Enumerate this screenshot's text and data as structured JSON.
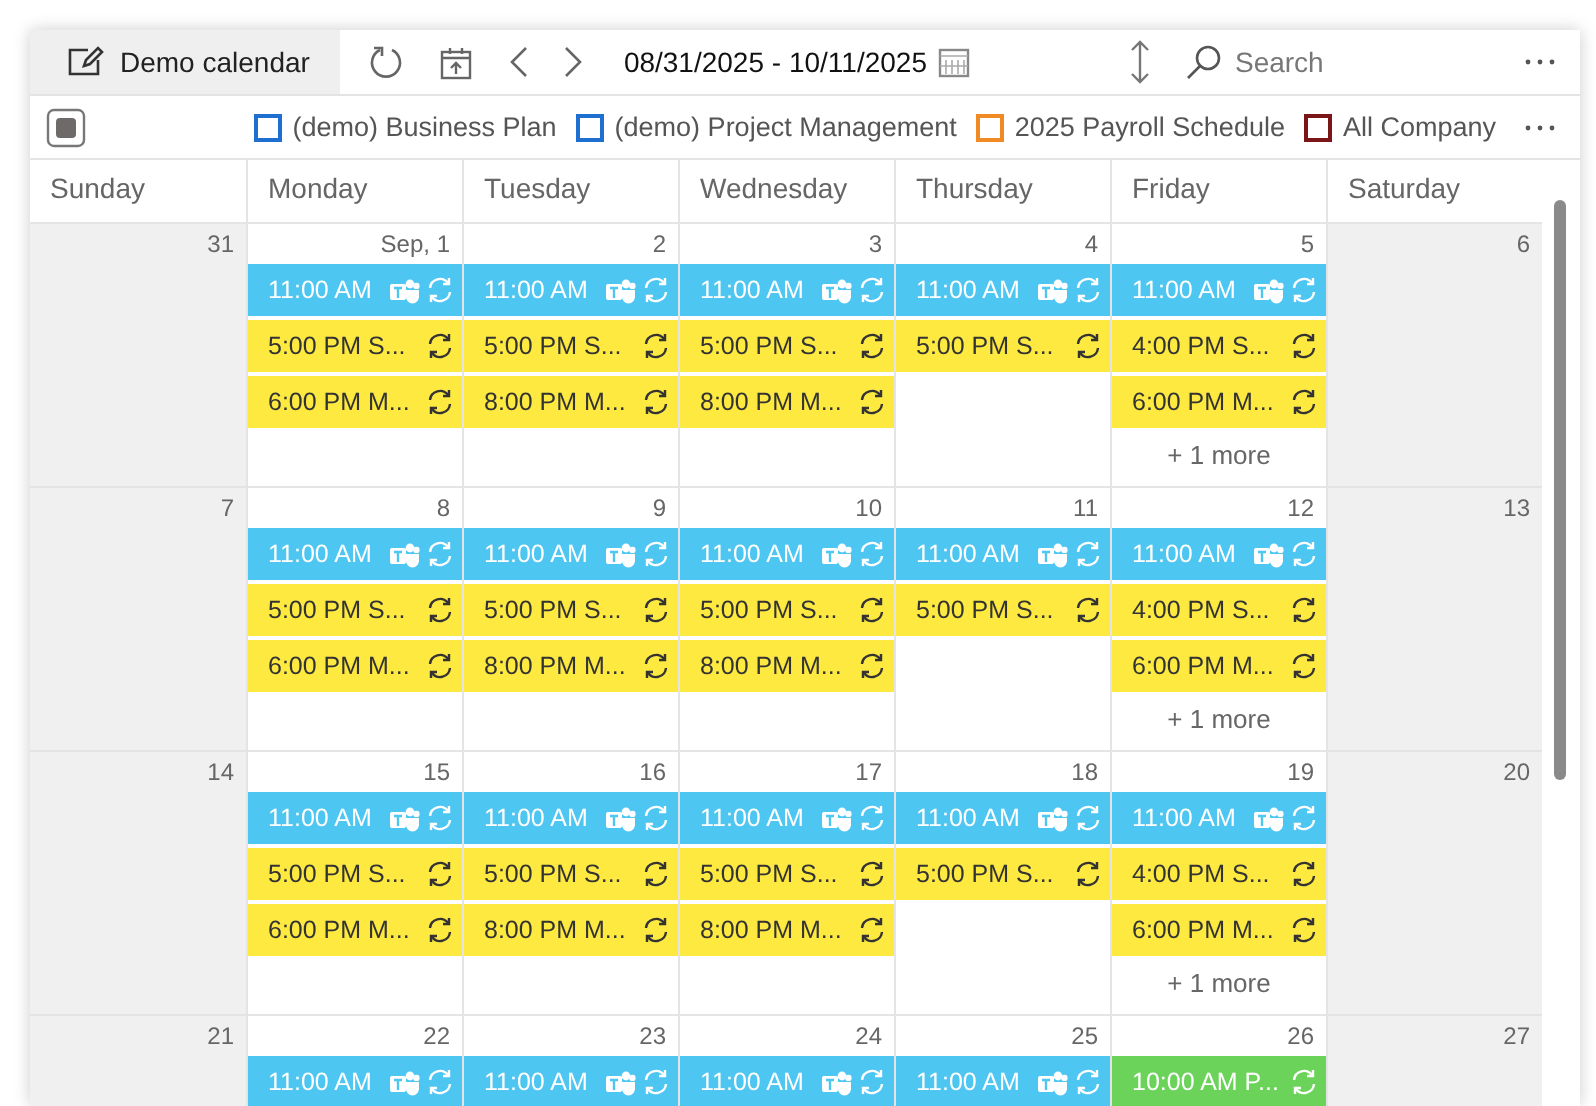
{
  "toolbar": {
    "calendar_button": {
      "label": "Demo calendar",
      "selected": true
    },
    "date_range": "08/31/2025 - 10/11/2025",
    "search": {
      "placeholder": "Search"
    }
  },
  "calendars": [
    {
      "name": "(demo) Business Plan",
      "color": "#1e6fd0",
      "checked": false
    },
    {
      "name": "(demo) Project Management",
      "color": "#1e6fd0",
      "checked": false
    },
    {
      "name": "2025 Payroll Schedule",
      "color": "#f08a24",
      "checked": false
    },
    {
      "name": "All Company",
      "color": "#7a1518",
      "checked": false
    }
  ],
  "weekdays": [
    "Sunday",
    "Monday",
    "Tuesday",
    "Wednesday",
    "Thursday",
    "Friday",
    "Saturday"
  ],
  "weeks": [
    {
      "days": [
        {
          "date": "31",
          "weekend": true
        },
        {
          "date": "Sep, 1",
          "weekend": false,
          "events": [
            {
              "text": "11:00 AM",
              "color": "#4dc6f2",
              "online_meeting": true,
              "recurring": true
            },
            {
              "text": "5:00 PM S...",
              "color": "#fde93f",
              "online_meeting": false,
              "recurring": true
            },
            {
              "text": "6:00 PM M...",
              "color": "#fde93f",
              "online_meeting": false,
              "recurring": true
            }
          ]
        },
        {
          "date": "2",
          "weekend": false,
          "events": [
            {
              "text": "11:00 AM",
              "color": "#4dc6f2",
              "online_meeting": true,
              "recurring": true
            },
            {
              "text": "5:00 PM S...",
              "color": "#fde93f",
              "online_meeting": false,
              "recurring": true
            },
            {
              "text": "8:00 PM M...",
              "color": "#fde93f",
              "online_meeting": false,
              "recurring": true
            }
          ]
        },
        {
          "date": "3",
          "weekend": false,
          "events": [
            {
              "text": "11:00 AM",
              "color": "#4dc6f2",
              "online_meeting": true,
              "recurring": true
            },
            {
              "text": "5:00 PM S...",
              "color": "#fde93f",
              "online_meeting": false,
              "recurring": true
            },
            {
              "text": "8:00 PM M...",
              "color": "#fde93f",
              "online_meeting": false,
              "recurring": true
            }
          ]
        },
        {
          "date": "4",
          "weekend": false,
          "events": [
            {
              "text": "11:00 AM",
              "color": "#4dc6f2",
              "online_meeting": true,
              "recurring": true
            },
            {
              "text": "5:00 PM S...",
              "color": "#fde93f",
              "online_meeting": false,
              "recurring": true
            }
          ]
        },
        {
          "date": "5",
          "weekend": false,
          "events": [
            {
              "text": "11:00 AM",
              "color": "#4dc6f2",
              "online_meeting": true,
              "recurring": true
            },
            {
              "text": "4:00 PM S...",
              "color": "#fde93f",
              "online_meeting": false,
              "recurring": true
            },
            {
              "text": "6:00 PM M...",
              "color": "#fde93f",
              "online_meeting": false,
              "recurring": true
            }
          ],
          "more": "+ 1 more"
        },
        {
          "date": "6",
          "weekend": true
        }
      ]
    },
    {
      "days": [
        {
          "date": "7",
          "weekend": true
        },
        {
          "date": "8",
          "weekend": false,
          "events": [
            {
              "text": "11:00 AM",
              "color": "#4dc6f2",
              "online_meeting": true,
              "recurring": true
            },
            {
              "text": "5:00 PM S...",
              "color": "#fde93f",
              "online_meeting": false,
              "recurring": true
            },
            {
              "text": "6:00 PM M...",
              "color": "#fde93f",
              "online_meeting": false,
              "recurring": true
            }
          ]
        },
        {
          "date": "9",
          "weekend": false,
          "events": [
            {
              "text": "11:00 AM",
              "color": "#4dc6f2",
              "online_meeting": true,
              "recurring": true
            },
            {
              "text": "5:00 PM S...",
              "color": "#fde93f",
              "online_meeting": false,
              "recurring": true
            },
            {
              "text": "8:00 PM M...",
              "color": "#fde93f",
              "online_meeting": false,
              "recurring": true
            }
          ]
        },
        {
          "date": "10",
          "weekend": false,
          "events": [
            {
              "text": "11:00 AM",
              "color": "#4dc6f2",
              "online_meeting": true,
              "recurring": true
            },
            {
              "text": "5:00 PM S...",
              "color": "#fde93f",
              "online_meeting": false,
              "recurring": true
            },
            {
              "text": "8:00 PM M...",
              "color": "#fde93f",
              "online_meeting": false,
              "recurring": true
            }
          ]
        },
        {
          "date": "11",
          "weekend": false,
          "events": [
            {
              "text": "11:00 AM",
              "color": "#4dc6f2",
              "online_meeting": true,
              "recurring": true
            },
            {
              "text": "5:00 PM S...",
              "color": "#fde93f",
              "online_meeting": false,
              "recurring": true
            }
          ]
        },
        {
          "date": "12",
          "weekend": false,
          "events": [
            {
              "text": "11:00 AM",
              "color": "#4dc6f2",
              "online_meeting": true,
              "recurring": true
            },
            {
              "text": "4:00 PM S...",
              "color": "#fde93f",
              "online_meeting": false,
              "recurring": true
            },
            {
              "text": "6:00 PM M...",
              "color": "#fde93f",
              "online_meeting": false,
              "recurring": true
            }
          ],
          "more": "+ 1 more"
        },
        {
          "date": "13",
          "weekend": true
        }
      ]
    },
    {
      "days": [
        {
          "date": "14",
          "weekend": true
        },
        {
          "date": "15",
          "weekend": false,
          "events": [
            {
              "text": "11:00 AM",
              "color": "#4dc6f2",
              "online_meeting": true,
              "recurring": true
            },
            {
              "text": "5:00 PM S...",
              "color": "#fde93f",
              "online_meeting": false,
              "recurring": true
            },
            {
              "text": "6:00 PM M...",
              "color": "#fde93f",
              "online_meeting": false,
              "recurring": true
            }
          ]
        },
        {
          "date": "16",
          "weekend": false,
          "events": [
            {
              "text": "11:00 AM",
              "color": "#4dc6f2",
              "online_meeting": true,
              "recurring": true
            },
            {
              "text": "5:00 PM S...",
              "color": "#fde93f",
              "online_meeting": false,
              "recurring": true
            },
            {
              "text": "8:00 PM M...",
              "color": "#fde93f",
              "online_meeting": false,
              "recurring": true
            }
          ]
        },
        {
          "date": "17",
          "weekend": false,
          "events": [
            {
              "text": "11:00 AM",
              "color": "#4dc6f2",
              "online_meeting": true,
              "recurring": true
            },
            {
              "text": "5:00 PM S...",
              "color": "#fde93f",
              "online_meeting": false,
              "recurring": true
            },
            {
              "text": "8:00 PM M...",
              "color": "#fde93f",
              "online_meeting": false,
              "recurring": true
            }
          ]
        },
        {
          "date": "18",
          "weekend": false,
          "events": [
            {
              "text": "11:00 AM",
              "color": "#4dc6f2",
              "online_meeting": true,
              "recurring": true
            },
            {
              "text": "5:00 PM S...",
              "color": "#fde93f",
              "online_meeting": false,
              "recurring": true
            }
          ]
        },
        {
          "date": "19",
          "weekend": false,
          "events": [
            {
              "text": "11:00 AM",
              "color": "#4dc6f2",
              "online_meeting": true,
              "recurring": true
            },
            {
              "text": "4:00 PM S...",
              "color": "#fde93f",
              "online_meeting": false,
              "recurring": true
            },
            {
              "text": "6:00 PM M...",
              "color": "#fde93f",
              "online_meeting": false,
              "recurring": true
            }
          ],
          "more": "+ 1 more"
        },
        {
          "date": "20",
          "weekend": true
        }
      ]
    },
    {
      "days": [
        {
          "date": "21",
          "weekend": true
        },
        {
          "date": "22",
          "weekend": false,
          "events": [
            {
              "text": "11:00 AM",
              "color": "#4dc6f2",
              "online_meeting": true,
              "recurring": true
            }
          ]
        },
        {
          "date": "23",
          "weekend": false,
          "events": [
            {
              "text": "11:00 AM",
              "color": "#4dc6f2",
              "online_meeting": true,
              "recurring": true
            }
          ]
        },
        {
          "date": "24",
          "weekend": false,
          "events": [
            {
              "text": "11:00 AM",
              "color": "#4dc6f2",
              "online_meeting": true,
              "recurring": true
            }
          ]
        },
        {
          "date": "25",
          "weekend": false,
          "events": [
            {
              "text": "11:00 AM",
              "color": "#4dc6f2",
              "online_meeting": true,
              "recurring": true
            }
          ]
        },
        {
          "date": "26",
          "weekend": false,
          "events": [
            {
              "text": "10:00 AM P...",
              "color": "#6cd35a",
              "online_meeting": false,
              "recurring": true
            }
          ]
        },
        {
          "date": "27",
          "weekend": true
        }
      ]
    }
  ]
}
